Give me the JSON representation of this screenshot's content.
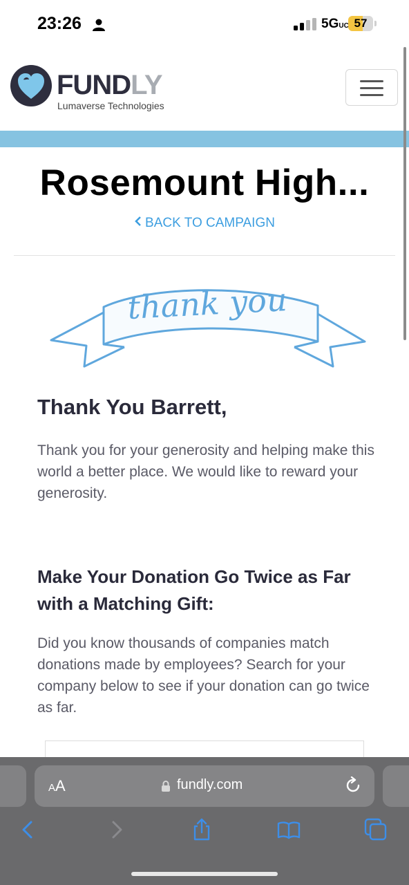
{
  "status_bar": {
    "time": "23:26",
    "network": "5G",
    "network_suffix": "UC",
    "battery": "57",
    "battery_level": 0.57
  },
  "header": {
    "brand_first": "FUND",
    "brand_second": "LY",
    "brand_sub": "Lumaverse Technologies"
  },
  "page": {
    "campaign_title": "Rosemount High...",
    "back_link": "BACK TO CAMPAIGN",
    "banner_text": "thank you",
    "thanks_heading": "Thank You Barrett,",
    "thanks_body": "Thank you for your generosity and helping make this world a better place. We would like to reward your generosity.",
    "match_heading": "Make Your Donation Go Twice as Far with a Matching Gift:",
    "match_body": "Did you know thousands of companies match donations made by employees? Search for your company below to see if your donation can go twice as far."
  },
  "browser": {
    "text_size_label": "AA",
    "url": "fundly.com"
  },
  "colors": {
    "accent": "#3d9ee0",
    "band": "#86c3e1",
    "banner": "#5fa7dd",
    "browser_bar": "#6a6a6c"
  }
}
